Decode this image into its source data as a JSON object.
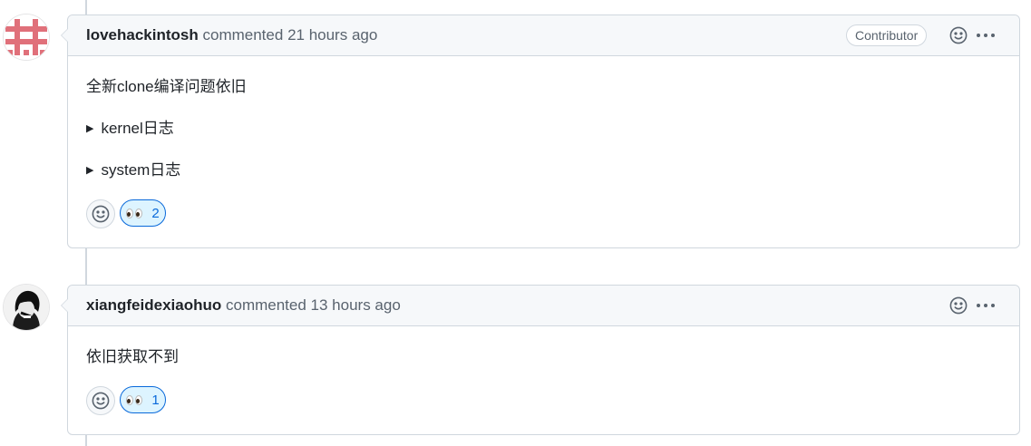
{
  "comments": [
    {
      "author": "lovehackintosh",
      "action": "commented",
      "time": "21 hours ago",
      "badge": "Contributor",
      "body_text": "全新clone编译问题依旧",
      "details": [
        "kernel日志",
        "system日志"
      ],
      "reactions": [
        {
          "emoji": "eyes",
          "count": "2"
        }
      ]
    },
    {
      "author": "xiangfeidexiaohuo",
      "action": "commented",
      "time": "13 hours ago",
      "body_text": "依旧获取不到",
      "reactions": [
        {
          "emoji": "eyes",
          "count": "1"
        }
      ]
    }
  ],
  "colors": {
    "accent": "#0969da",
    "reaction_bg": "#ddf4ff",
    "header_bg": "#f6f8fa",
    "border": "#d0d7de",
    "avatar1_pink": "#e0707a"
  },
  "icons": {
    "add_reaction": "smiley-icon",
    "menu": "kebab-horizontal-icon",
    "details_marker": "triangle-right-icon"
  },
  "triangle_glyph": "▶"
}
